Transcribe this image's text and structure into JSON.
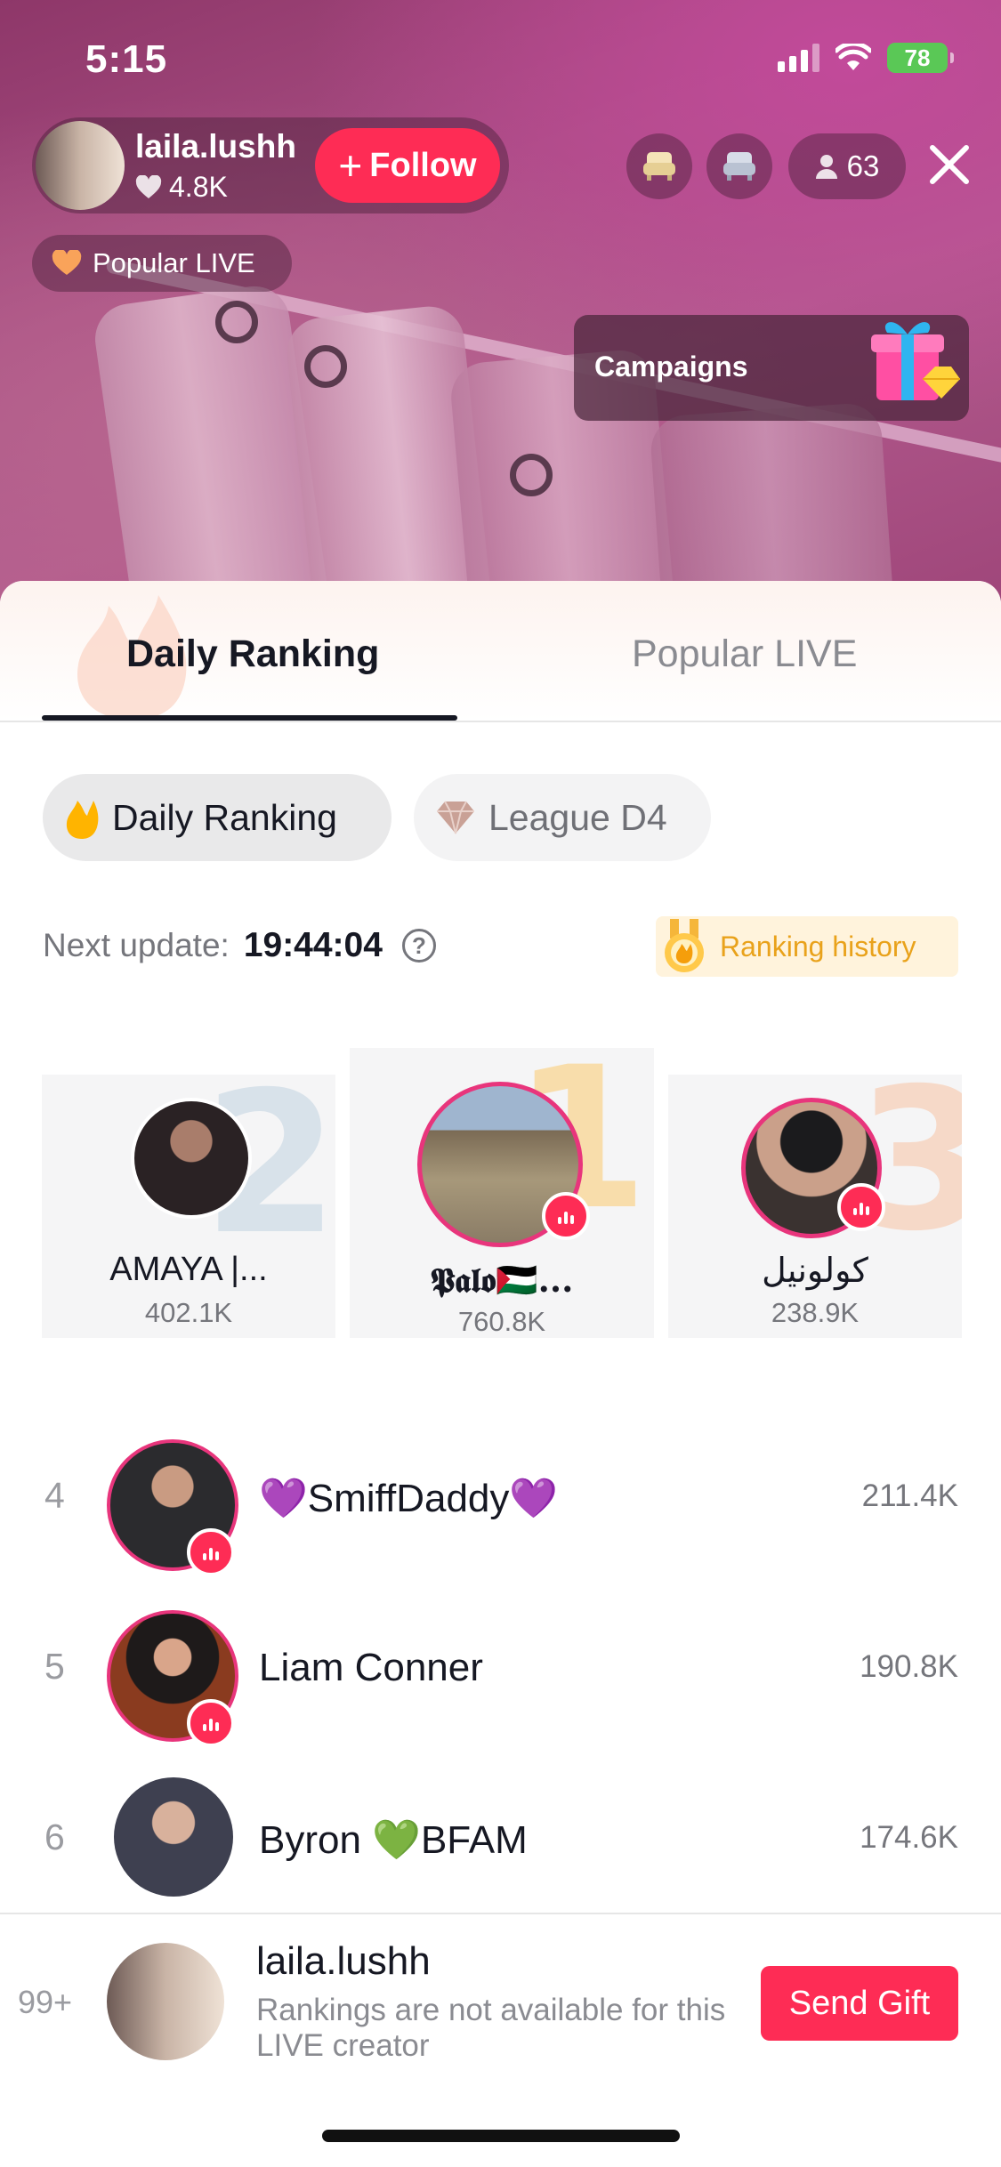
{
  "status_bar": {
    "time": "5:15",
    "battery": "78"
  },
  "host": {
    "name": "laila.lushh",
    "likes": "4.8K",
    "follow_label": "Follow"
  },
  "top_bar": {
    "viewer_count": "63"
  },
  "popular_live_badge": "Popular LIVE",
  "campaigns_label": "Campaigns",
  "ranking": {
    "tabs": [
      {
        "label": "Daily Ranking",
        "active": true
      },
      {
        "label": "Popular LIVE",
        "active": false
      }
    ],
    "chips": {
      "daily": "Daily Ranking",
      "league": "League D4"
    },
    "next_update_label": "Next update:",
    "next_update_time": "19:44:04",
    "history_label": "Ranking history",
    "podium": [
      {
        "rank": "2",
        "name": "AMAYA |...",
        "score": "402.1K"
      },
      {
        "rank": "1",
        "name": "𝕻𝖆𝖑𝖔🇵🇸...",
        "score": "760.8K"
      },
      {
        "rank": "3",
        "name": "كولونيل",
        "score": "238.9K"
      }
    ],
    "list": [
      {
        "rank": "4",
        "name": "💜SmiffDaddy💜",
        "score": "211.4K"
      },
      {
        "rank": "5",
        "name": "Liam Conner",
        "score": "190.8K"
      },
      {
        "rank": "6",
        "name": "Byron 💚BFAM",
        "score": "174.6K"
      }
    ],
    "self": {
      "rank": "99+",
      "name": "laila.lushh",
      "note": "Rankings are not available for this LIVE creator",
      "send_gift_label": "Send Gift"
    }
  },
  "colors": {
    "accent": "#fe2c55",
    "live_ring": "#e8357c",
    "history": "#e9a21b"
  }
}
